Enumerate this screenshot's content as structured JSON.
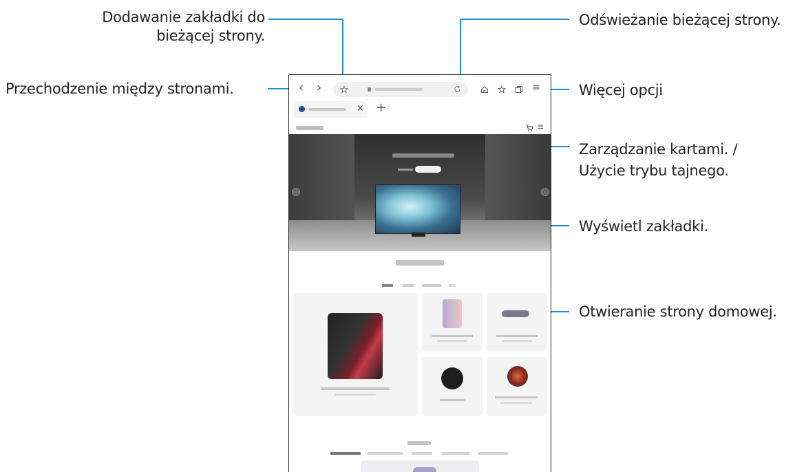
{
  "callouts": {
    "bookmark_add": "Dodawanie zakładki do bieżącej strony.",
    "bookmark_add_line1": "Dodawanie zakładki do",
    "bookmark_add_line2": "bieżącej strony.",
    "navigate": "Przechodzenie między stronami.",
    "refresh": "Odświeżanie bieżącej strony.",
    "more": "Więcej opcji",
    "tabs_line1": "Zarządzanie kartami. /",
    "tabs_line2": "Użycie trybu tajnego.",
    "view_bookmarks": "Wyświetl zakładki.",
    "home": "Otwieranie strony domowej."
  },
  "browser": {
    "nav_back": "‹",
    "nav_forward": "›",
    "tab_close": "×",
    "new_tab": "+",
    "menu": "≡"
  },
  "colors": {
    "callout_line": "#1a8fc8",
    "hero_bg": "#3a3a3a"
  },
  "icons": [
    "chevron-left-icon",
    "chevron-right-icon",
    "star-icon",
    "lock-icon",
    "refresh-icon",
    "home-icon",
    "bookmarks-icon",
    "tabs-icon",
    "menu-icon",
    "cart-icon",
    "close-icon",
    "plus-icon"
  ]
}
